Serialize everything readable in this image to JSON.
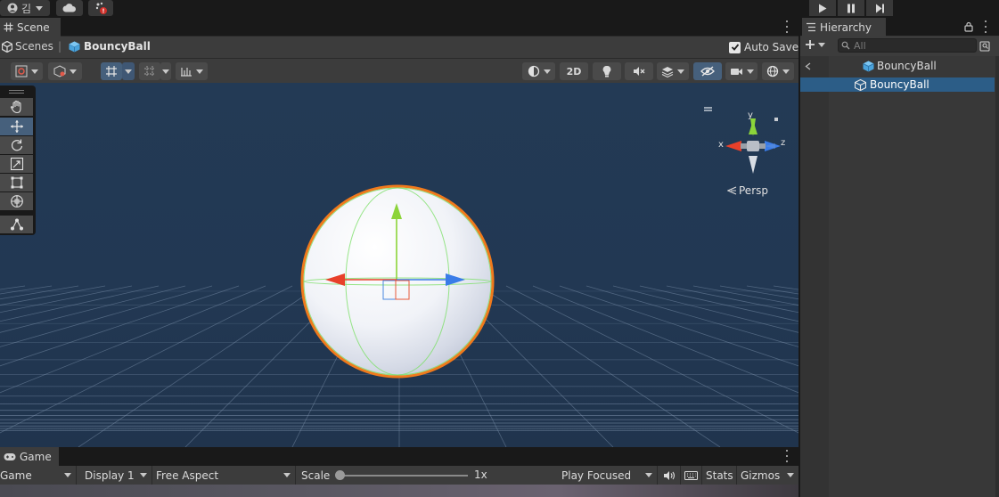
{
  "topbar": {
    "account_label": "김",
    "play_controls": [
      "play",
      "pause",
      "step"
    ]
  },
  "scene": {
    "tab_label": "Scene",
    "breadcrumb": {
      "root": "Scenes",
      "separator": "|",
      "current": "BouncyBall"
    },
    "auto_save": {
      "label": "Auto Save",
      "checked": true
    },
    "toolbar": {
      "mode_2d_label": "2D"
    },
    "gizmo": {
      "axis_y": "y",
      "axis_x": "x",
      "axis_z": "z",
      "projection_label": "Persp"
    }
  },
  "hierarchy": {
    "tab_label": "Hierarchy",
    "search_placeholder": "All",
    "scene_root": "BouncyBall",
    "items": [
      {
        "label": "BouncyBall",
        "selected": true
      }
    ]
  },
  "game": {
    "tab_label": "Game",
    "view_select": "Game",
    "display_select": "Display 1",
    "aspect_select": "Free Aspect",
    "scale_label": "Scale",
    "scale_value": "1x",
    "scale_fraction": 0.0,
    "play_mode_select": "Play Focused",
    "stats_label": "Stats",
    "gizmos_label": "Gizmos"
  },
  "colors": {
    "accent_selected": "#2c5d87",
    "tool_active": "#46607c",
    "viewport_bg": "#223853",
    "selection_outline": "#f07a1c",
    "axis_x": "#e8402a",
    "axis_y": "#8cd43a",
    "axis_z": "#3a7ce8"
  }
}
